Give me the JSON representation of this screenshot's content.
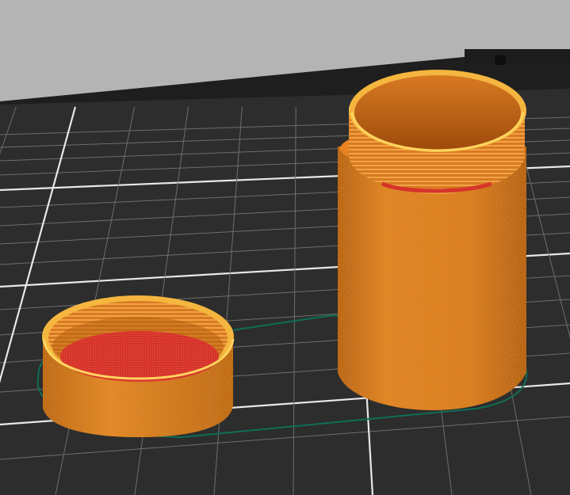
{
  "scene": {
    "background_color": "#b4b4b4",
    "bed_color": "#2d2d2d",
    "bed_back_edge_color": "#1e1e1e",
    "grid_minor_color": "#6e6e6e",
    "grid_major_color": "#e8e8e8",
    "skirt_color": "#0f6e57",
    "perimeter_color": "#e07a1a",
    "perimeter_dark_color": "#a94f0c",
    "rim_color": "#f7c24a",
    "top_surface_color": "#d9352a",
    "inner_wall_color": "#c96f1c"
  },
  "objects": [
    {
      "name": "jar-body"
    },
    {
      "name": "jar-lid"
    }
  ]
}
